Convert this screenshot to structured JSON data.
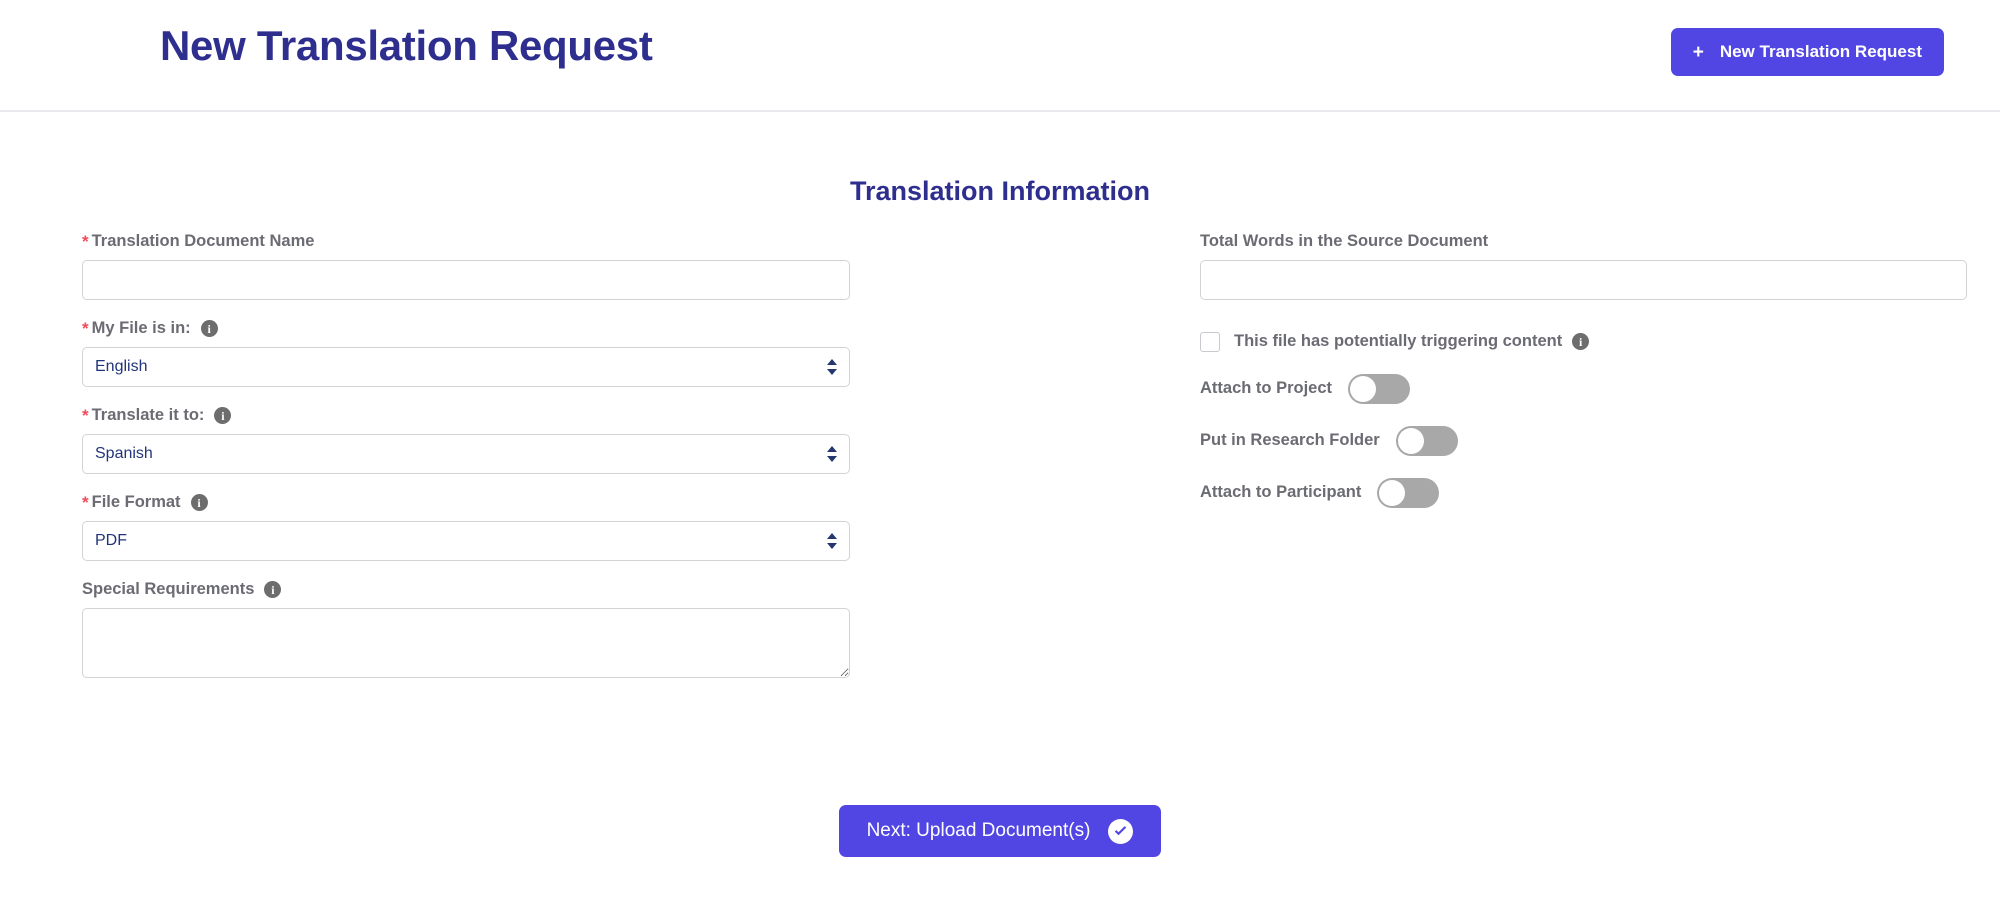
{
  "header": {
    "title": "New Translation Request",
    "action_button": {
      "label": "New Translation Request",
      "plus_glyph": "+",
      "icon": "plus-icon",
      "color": "#5146e3"
    }
  },
  "section": {
    "heading": "Translation Information",
    "heading_color": "#2e2e8f"
  },
  "form": {
    "left": {
      "document_name": {
        "label": "Translation Document Name",
        "required": true,
        "required_marker": "*",
        "value": "",
        "placeholder": ""
      },
      "source_language": {
        "label": "My File is in:",
        "required": true,
        "required_marker": "*",
        "info_icon": "info-icon",
        "value": "English",
        "options": [
          "English"
        ]
      },
      "target_language": {
        "label": "Translate it to:",
        "required": true,
        "required_marker": "*",
        "info_icon": "info-icon",
        "value": "Spanish",
        "options": [
          "Spanish"
        ]
      },
      "file_format": {
        "label": "File Format",
        "required": true,
        "required_marker": "*",
        "info_icon": "info-icon",
        "value": "PDF",
        "options": [
          "PDF"
        ]
      },
      "special_requirements": {
        "label": "Special Requirements",
        "required": false,
        "info_icon": "info-icon",
        "value": "",
        "placeholder": ""
      }
    },
    "right": {
      "total_words": {
        "label": "Total Words in the Source Document",
        "required": false,
        "value": "",
        "placeholder": ""
      },
      "triggering_content": {
        "label": "This file has potentially triggering content",
        "checked": false,
        "info_icon": "info-icon"
      },
      "toggles": [
        {
          "label": "Attach to Project",
          "on": false
        },
        {
          "label": "Put in Research Folder",
          "on": false
        },
        {
          "label": "Attach to Participant",
          "on": false
        }
      ]
    }
  },
  "footer": {
    "next_button": {
      "label": "Next: Upload Document(s)",
      "icon": "check-circle-icon",
      "color": "#5146e3"
    }
  },
  "colors": {
    "brand_purple": "#5146e3",
    "heading_navy": "#2e2e8f",
    "label_gray": "#6b6b73",
    "required_red": "#f04b5a",
    "toggle_off_gray": "#a8a8a8",
    "border_gray": "#d3d3d6"
  }
}
